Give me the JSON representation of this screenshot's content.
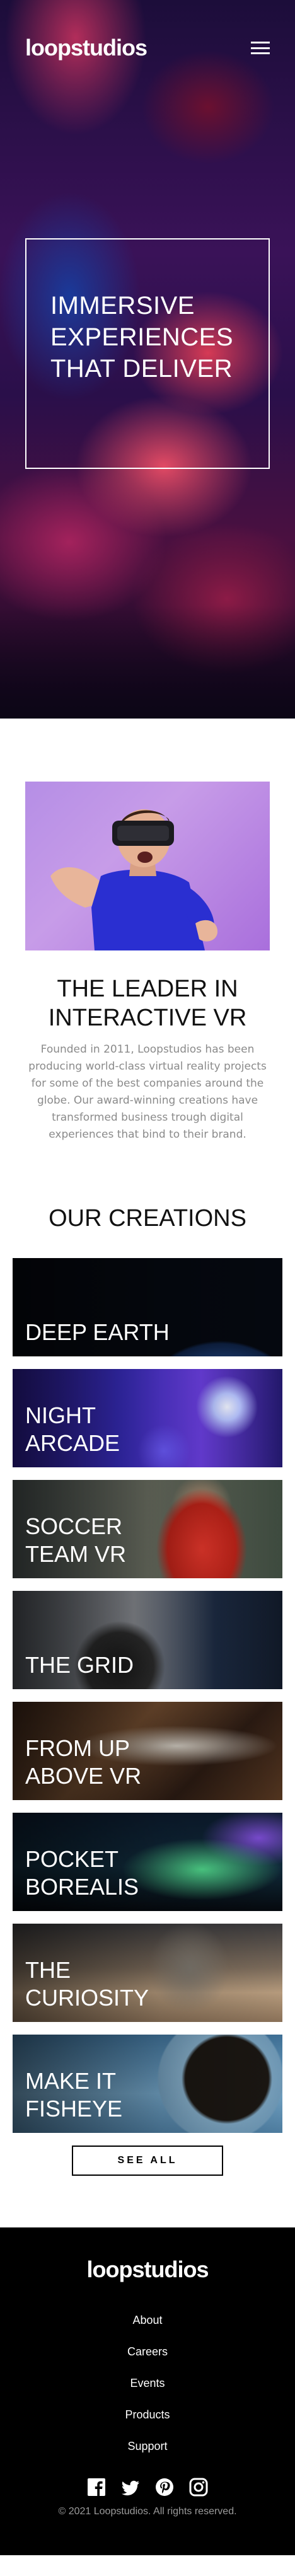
{
  "header": {
    "logo": "loopstudios",
    "menu_icon": "hamburger-menu-icon"
  },
  "hero": {
    "title": "Immersive experiences that deliver"
  },
  "about": {
    "title": "The leader in interactive VR",
    "text": "Founded in 2011, Loopstudios has been producing world-class virtual reality projects for some of the best companies around the globe. Our award-winning creations have transformed business trough digital experiences that bind to their brand."
  },
  "creations": {
    "title": "Our creations",
    "items": [
      {
        "label": "Deep earth"
      },
      {
        "label": "Night arcade"
      },
      {
        "label": "Soccer team VR"
      },
      {
        "label": "The grid"
      },
      {
        "label": "From up above VR"
      },
      {
        "label": "Pocket borealis"
      },
      {
        "label": "The curiosity"
      },
      {
        "label": "Make it fisheye"
      }
    ],
    "see_all": "SEE ALL"
  },
  "footer": {
    "logo": "loopstudios",
    "nav": [
      "About",
      "Careers",
      "Events",
      "Products",
      "Support"
    ],
    "social_icons": [
      "facebook-icon",
      "twitter-icon",
      "pinterest-icon",
      "instagram-icon"
    ],
    "copyright": "© 2021 Loopstudios. All rights reserved."
  }
}
